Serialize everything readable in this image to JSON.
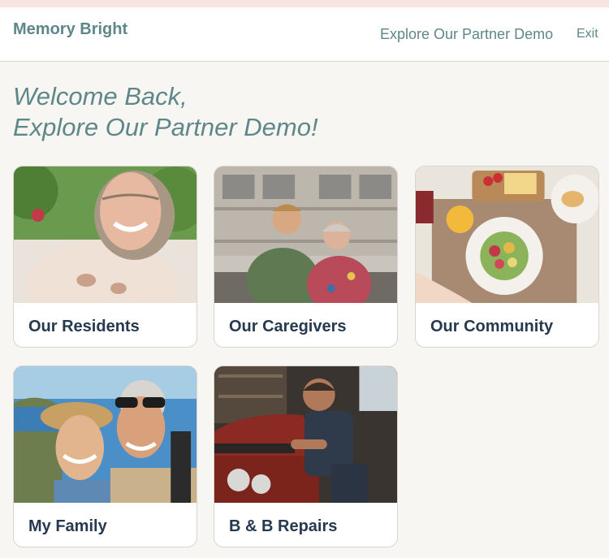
{
  "header": {
    "brand": "Memory Bright",
    "nav_demo": "Explore Our Partner Demo",
    "nav_exit": "Exit"
  },
  "welcome": {
    "line1": "Welcome Back,",
    "line2": "Explore Our Partner Demo!"
  },
  "cards": [
    {
      "label": "Our Residents",
      "photo": "smiling-elderly-woman-photo"
    },
    {
      "label": "Our Caregivers",
      "photo": "caregiver-with-elderly-woman-photo"
    },
    {
      "label": "Our Community",
      "photo": "shared-meal-table-photo"
    },
    {
      "label": "My Family",
      "photo": "elderly-couple-selfie-photo"
    },
    {
      "label": "B & B Repairs",
      "photo": "mechanic-fixing-car-photo"
    }
  ],
  "colors": {
    "accent": "#5e8789",
    "heading_dark": "#25394f",
    "background": "#f8f6f2",
    "top_strip": "#f7e3e1"
  }
}
